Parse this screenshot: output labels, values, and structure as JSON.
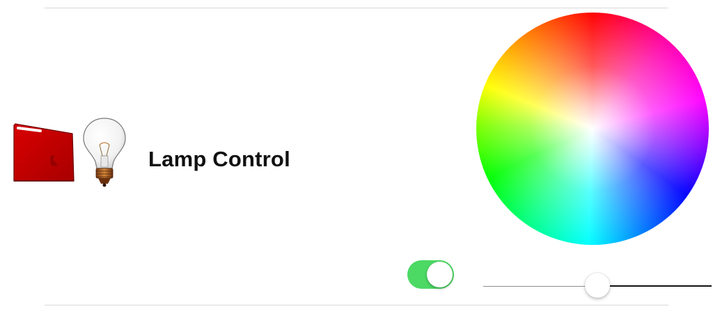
{
  "header": {
    "title": "Lamp Control"
  },
  "icons": {
    "device": "red-device-icon",
    "lamp": "light-bulb-icon"
  },
  "controls": {
    "power_toggle": {
      "on": true,
      "color": "#4cd964"
    },
    "brightness_slider": {
      "value": 0.5
    },
    "color_picker": {
      "type": "hue-wheel"
    }
  },
  "colors": {
    "device": "#c40000",
    "toggle_on": "#4cd964",
    "text": "#111111"
  }
}
